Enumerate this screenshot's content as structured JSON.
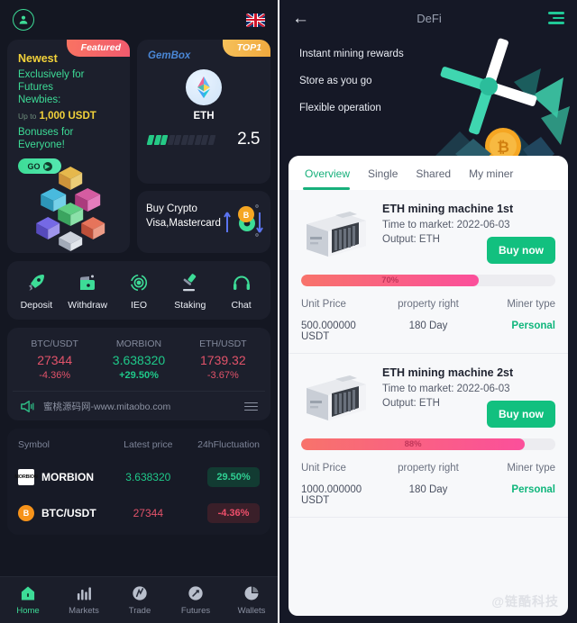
{
  "left": {
    "topbar": {
      "avatar_icon": "user-avatar-icon",
      "flag_icon": "uk-flag-icon"
    },
    "promo": {
      "ribbon": "Featured",
      "title": "Newest",
      "line1": "Exclusively for Futures",
      "line2": "Newbies:",
      "upto": "Up to",
      "amount": "1,000 USDT",
      "line3": "Bonuses for Everyone!",
      "cta": "GO"
    },
    "gembox": {
      "label": "GemBox",
      "ribbon": "TOP1",
      "symbol": "ETH",
      "value": "2.5",
      "bars_total": 10,
      "bars_filled": 3
    },
    "buy_crypto": {
      "line1": "Buy Crypto",
      "line2": "Visa,Mastercard"
    },
    "quick_actions": [
      {
        "label": "Deposit",
        "icon": "rocket-icon"
      },
      {
        "label": "Withdraw",
        "icon": "wallet-icon"
      },
      {
        "label": "IEO",
        "icon": "atom-icon"
      },
      {
        "label": "Staking",
        "icon": "gavel-icon"
      },
      {
        "label": "Chat",
        "icon": "headset-icon"
      }
    ],
    "tickers": [
      {
        "symbol": "BTC/USDT",
        "price": "27344",
        "change": "-4.36%",
        "dir": "down",
        "price_dir": "down"
      },
      {
        "symbol": "MORBION",
        "price": "3.638320",
        "change": "+29.50%",
        "dir": "up",
        "price_dir": "up"
      },
      {
        "symbol": "ETH/USDT",
        "price": "1739.32",
        "change": "-3.67%",
        "dir": "down",
        "price_dir": "down"
      }
    ],
    "notice": {
      "icon": "megaphone-icon",
      "text": "蜜桃源码网-www.mitaobo.com",
      "menu_icon": "list-icon"
    },
    "market": {
      "headers": [
        "Symbol",
        "Latest price",
        "24hFluctuation"
      ],
      "rows": [
        {
          "icon": "morbion-logo-icon",
          "symbol": "MORBION",
          "price": "3.638320",
          "change": "29.50%",
          "dir": "up"
        },
        {
          "icon": "bitcoin-logo-icon",
          "symbol": "BTC/USDT",
          "price": "27344",
          "change": "-4.36%",
          "dir": "down"
        }
      ]
    },
    "bottom_nav": [
      {
        "label": "Home",
        "icon": "home-icon",
        "active": true
      },
      {
        "label": "Markets",
        "icon": "bar-chart-icon",
        "active": false
      },
      {
        "label": "Trade",
        "icon": "trade-icon",
        "active": false
      },
      {
        "label": "Futures",
        "icon": "futures-icon",
        "active": false
      },
      {
        "label": "Wallets",
        "icon": "pie-chart-icon",
        "active": false
      }
    ],
    "colors": {
      "accent": "#3ddc97",
      "up": "#1fc98a",
      "down": "#e2536a",
      "bg": "#141722",
      "card": "#1c1f2c"
    }
  },
  "right": {
    "topbar": {
      "back_icon": "back-arrow-icon",
      "title": "DeFi",
      "menu_icon": "hamburger-menu-icon"
    },
    "hero": {
      "lines": [
        "Instant mining rewards",
        "Store as you go",
        "Flexible operation"
      ],
      "art_icon": "mining-windmill-illustration"
    },
    "tabs": [
      {
        "label": "Overview",
        "active": true
      },
      {
        "label": "Single",
        "active": false
      },
      {
        "label": "Shared",
        "active": false
      },
      {
        "label": "My miner",
        "active": false
      }
    ],
    "miners": [
      {
        "image_icon": "asic-miner-photo",
        "name": "ETH mining machine 1st",
        "time_label": "Time to market:",
        "time_value": "2022-06-03",
        "output_label": "Output:",
        "output_value": "ETH",
        "buy_label": "Buy now",
        "progress": 70,
        "progress_text": "70%",
        "col_headers": [
          "Unit Price",
          "property right",
          "Miner type"
        ],
        "values": [
          "500.000000 USDT",
          "180 Day",
          "Personal"
        ]
      },
      {
        "image_icon": "asic-miner-photo",
        "name": "ETH mining machine 2st",
        "time_label": "Time to market:",
        "time_value": "2022-06-03",
        "output_label": "Output:",
        "output_value": "ETH",
        "buy_label": "Buy now",
        "progress": 88,
        "progress_text": "88%",
        "col_headers": [
          "Unit Price",
          "property right",
          "Miner type"
        ],
        "values": [
          "1000.000000 USDT",
          "180 Day",
          "Personal"
        ]
      }
    ],
    "watermark": "@链酷科技",
    "colors": {
      "accent": "#17b07b",
      "buy": "#12c07f",
      "progress_from": "#f8736b",
      "progress_to": "#fb4f9b",
      "sheet_bg": "#f7f8fa"
    }
  }
}
